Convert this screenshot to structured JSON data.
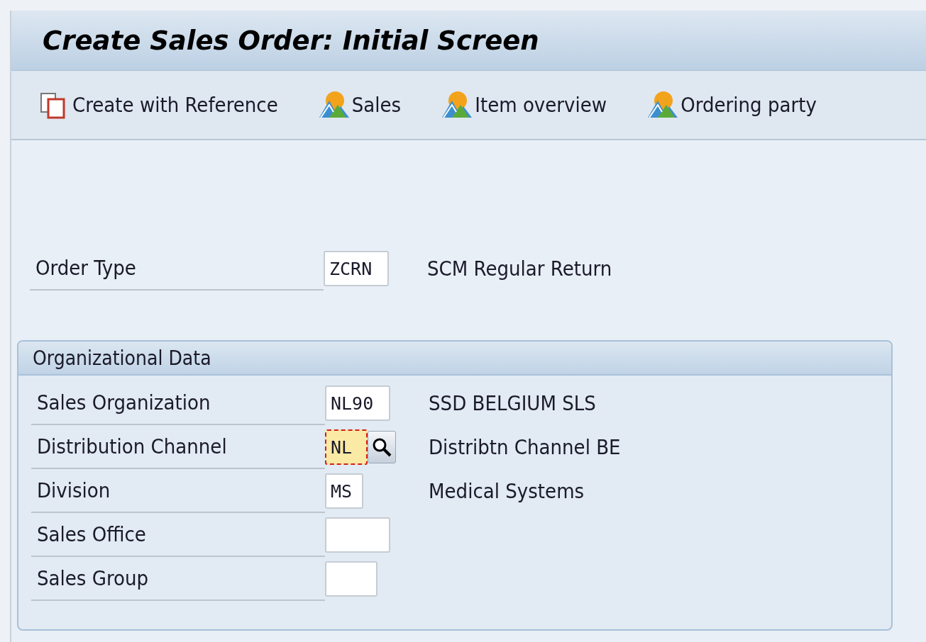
{
  "window": {
    "title": "Create Sales Order: Initial Screen"
  },
  "toolbar": [
    {
      "kind": "copy",
      "label": "Create with Reference"
    },
    {
      "kind": "mountain",
      "label": "Sales"
    },
    {
      "kind": "mountain",
      "label": "Item overview"
    },
    {
      "kind": "mountain",
      "label": "Ordering party"
    }
  ],
  "order_type": {
    "label": "Order Type",
    "value": "ZCRN",
    "description": "SCM Regular Return",
    "focused": false
  },
  "org_data": {
    "title": "Organizational Data",
    "fields": [
      {
        "label": "Sales Organization",
        "value": "NL90",
        "description": "SSD BELGIUM SLS",
        "focused": false
      },
      {
        "label": "Distribution Channel",
        "value": "NL",
        "description": "Distribtn Channel BE",
        "focused": true
      },
      {
        "label": "Division",
        "value": "MS",
        "description": "Medical Systems",
        "focused": false
      },
      {
        "label": "Sales Office",
        "focused": false
      },
      {
        "label": "Sales Group",
        "focused": false
      }
    ]
  }
}
